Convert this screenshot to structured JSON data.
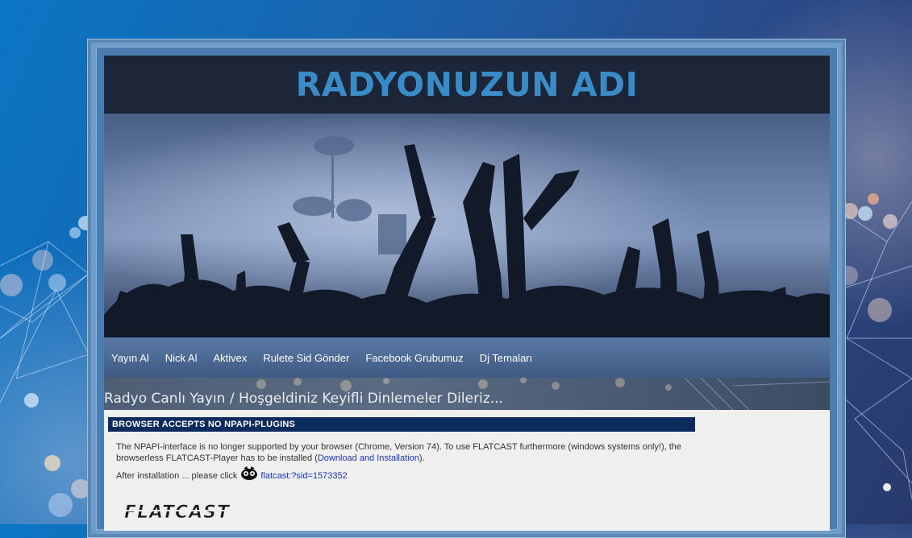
{
  "site": {
    "title": "RADYONUZUN ADI",
    "welcome_text": "Radyo Canlı Yayın / Hoşgeldiniz Keyifli Dinlemeler Dileriz..."
  },
  "nav": {
    "items": [
      {
        "label": "Yayın Al"
      },
      {
        "label": "Nick Al"
      },
      {
        "label": "Aktivex"
      },
      {
        "label": "Rulete Sid Gönder"
      },
      {
        "label": "Facebook Grubumuz"
      },
      {
        "label": "Dj Temaları"
      }
    ]
  },
  "plugin": {
    "title": "BROWSER ACCEPTS NO NPAPI-PLUGINS",
    "message_before": "The NPAPI-interface is no longer supported by your browser (Chrome, Version 74). To use FLATCAST furthermore (windows systems only!), the browserless FLATCAST-Player has to be installed (",
    "download_link": "Download and Installation",
    "message_after": ").",
    "after_text": "After installation ... please click",
    "player_link": "flatcast:?sid=1573352",
    "logo_text": "FLATCAST"
  },
  "colors": {
    "title": "#3a8cc8",
    "header_bg": "#1c2638",
    "plugin_title_bg": "#0b2a5e",
    "link": "#1a35b5"
  },
  "icons": [
    "flatcast-player-icon"
  ]
}
